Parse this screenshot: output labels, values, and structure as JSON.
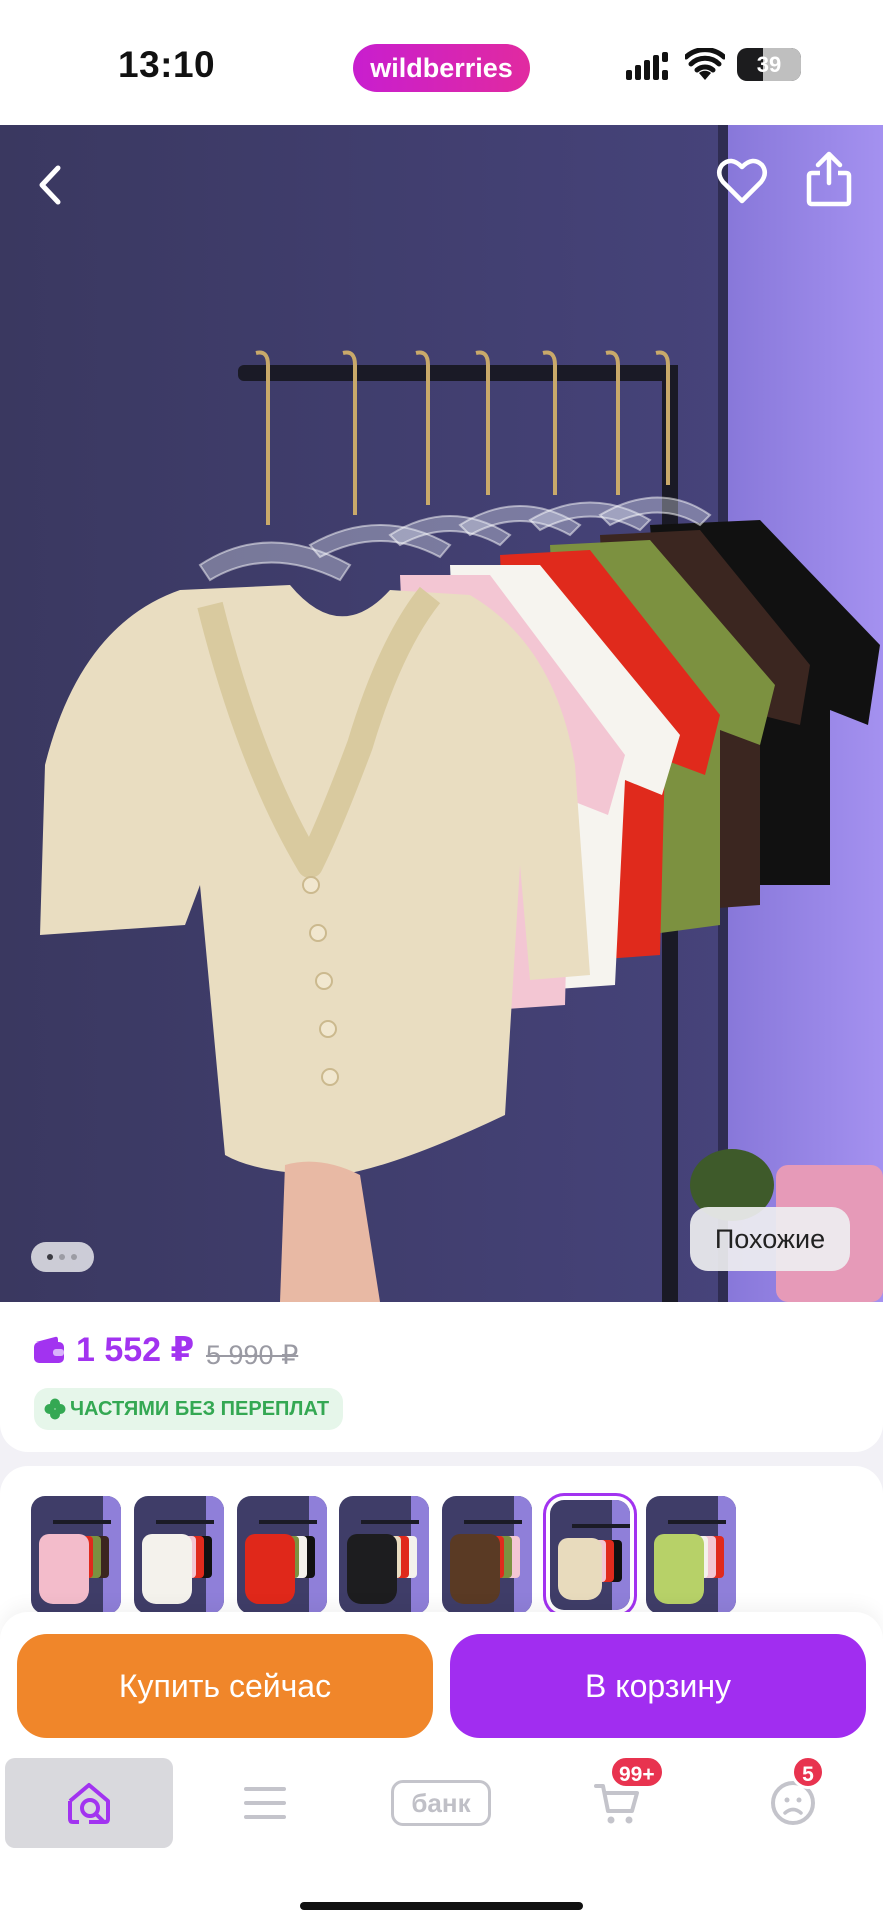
{
  "status_bar": {
    "time": "13:10",
    "battery": "39",
    "app_badge": "wildberries"
  },
  "product": {
    "price": "1 552 ₽",
    "old_price": "5 990 ₽",
    "installment": "ЧАСТЯМИ БЕЗ ПЕРЕПЛАТ"
  },
  "hero": {
    "similar_label": "Похожие",
    "gallery_dots": {
      "count": 3,
      "active": 1
    },
    "garment_colors": [
      "#e9ddc1",
      "#f3c6d3",
      "#f6f4ef",
      "#e02a1c",
      "#7c9140",
      "#3b2620",
      "#111111"
    ]
  },
  "variants": [
    {
      "name": "pink",
      "color": "#f3bccb"
    },
    {
      "name": "white",
      "color": "#f4f2ec"
    },
    {
      "name": "red",
      "color": "#e0281a"
    },
    {
      "name": "black",
      "color": "#1d1d1f"
    },
    {
      "name": "brown",
      "color": "#5a3a24"
    },
    {
      "name": "beige",
      "color": "#e8dbbd",
      "selected": true
    },
    {
      "name": "green",
      "color": "#b7d168"
    }
  ],
  "actions": {
    "buy_now": "Купить сейчас",
    "add_to_cart": "В корзину"
  },
  "nav": {
    "items": [
      {
        "icon": "home-search-icon",
        "active": true
      },
      {
        "icon": "menu-icon"
      },
      {
        "label": "банк",
        "icon": "bank-icon"
      },
      {
        "icon": "cart-icon",
        "badge": "99+"
      },
      {
        "icon": "profile-icon",
        "badge": "5"
      }
    ]
  },
  "colors": {
    "accent": "#a233f0",
    "orange": "#f0862a",
    "green": "#34a853",
    "badge_red": "#e8334f"
  }
}
